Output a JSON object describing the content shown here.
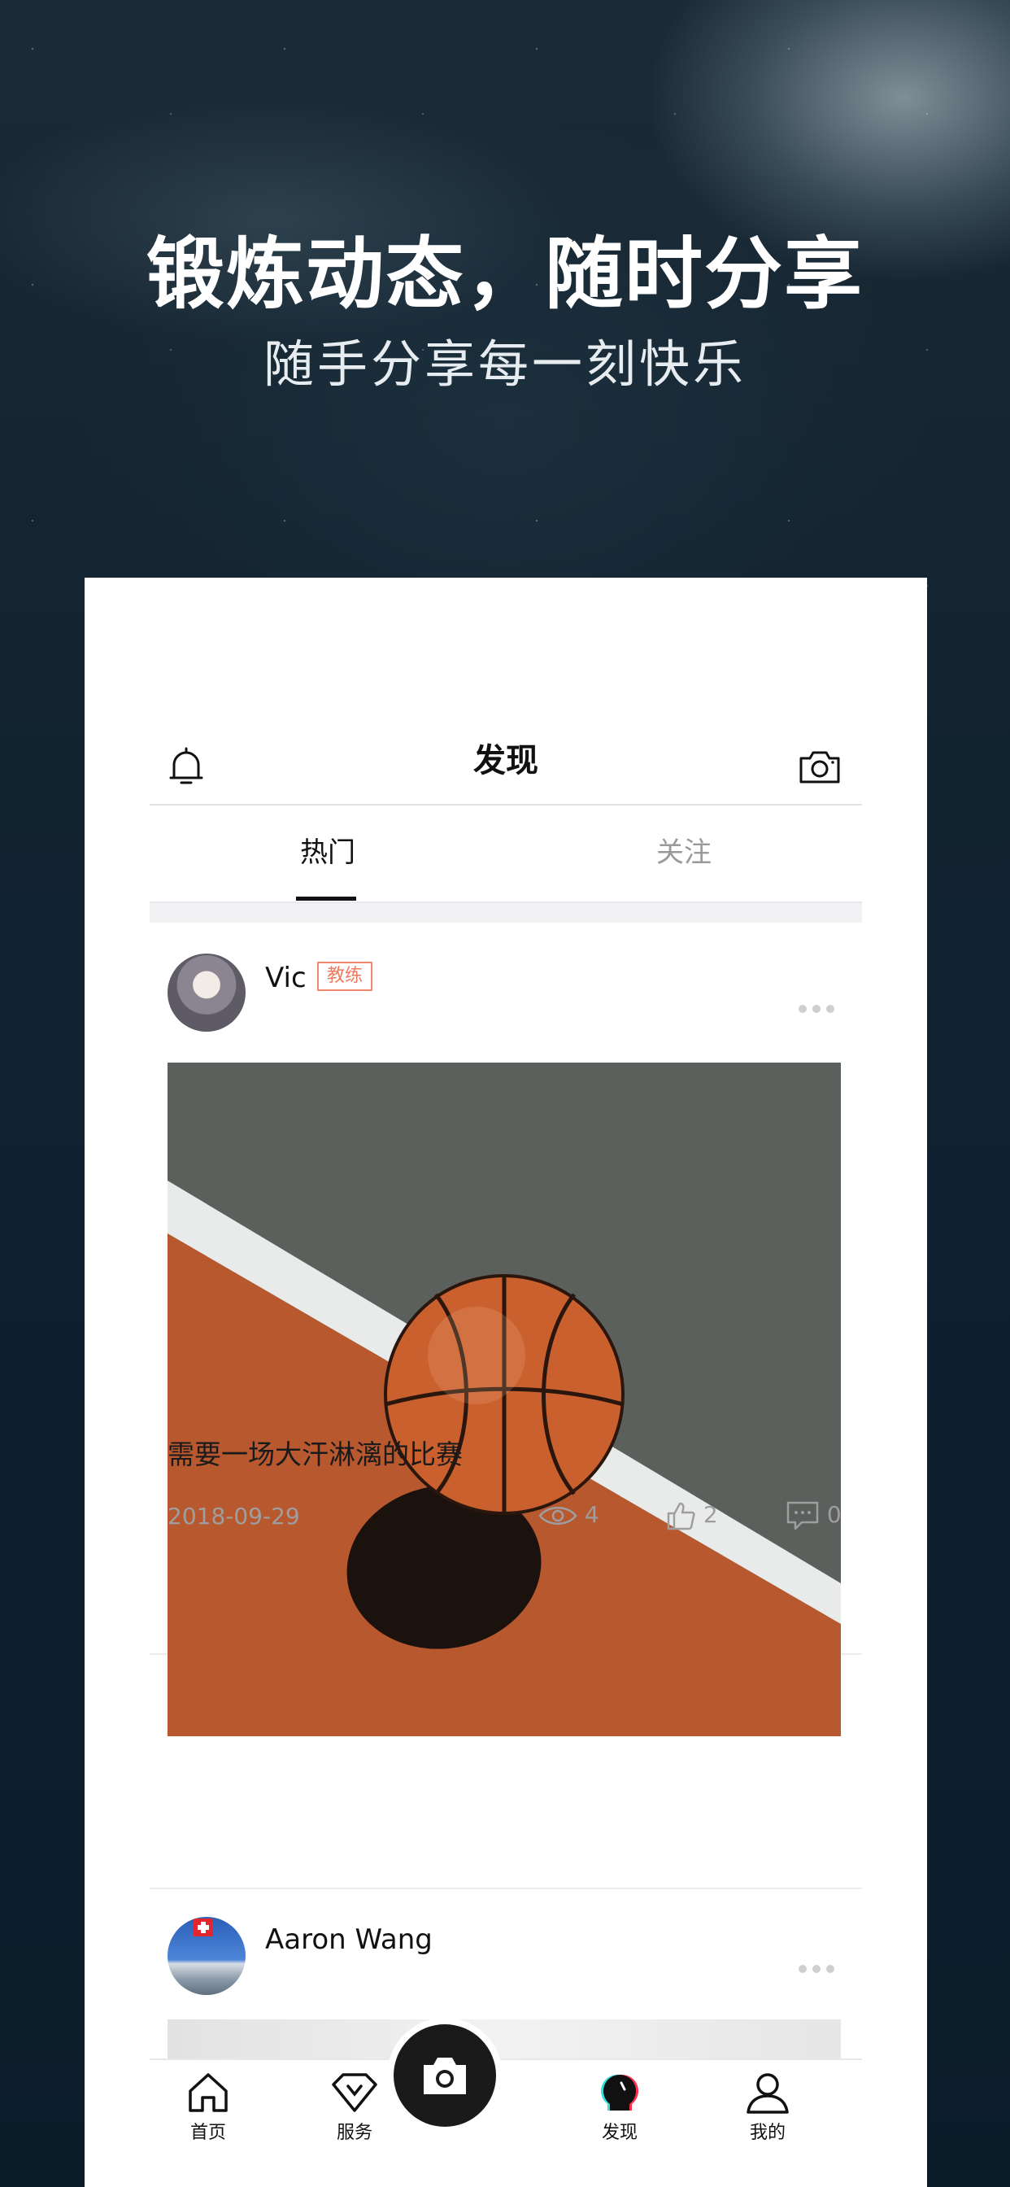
{
  "hero": {
    "title": "锻炼动态，随时分享",
    "subtitle": "随手分享每一刻快乐"
  },
  "navbar": {
    "title": "发现",
    "left_icon": "bell-icon",
    "right_icon": "camera-icon"
  },
  "tabs": {
    "hot": "热门",
    "follow": "关注",
    "active": "hot"
  },
  "posts": [
    {
      "user": "Vic",
      "badge": "教练",
      "caption": "需要一场大汗淋漓的比赛",
      "date": "2018-09-29",
      "views": "4",
      "likes": "2",
      "comments": "0"
    },
    {
      "user": "Aaron Wang"
    }
  ],
  "tabbar": {
    "home": "首页",
    "service": "服务",
    "discover": "发现",
    "mine": "我的",
    "center_icon": "camera-icon"
  },
  "colors": {
    "badge": "#ee7a5f",
    "accent": "#111111",
    "muted": "#9e9e9e"
  }
}
